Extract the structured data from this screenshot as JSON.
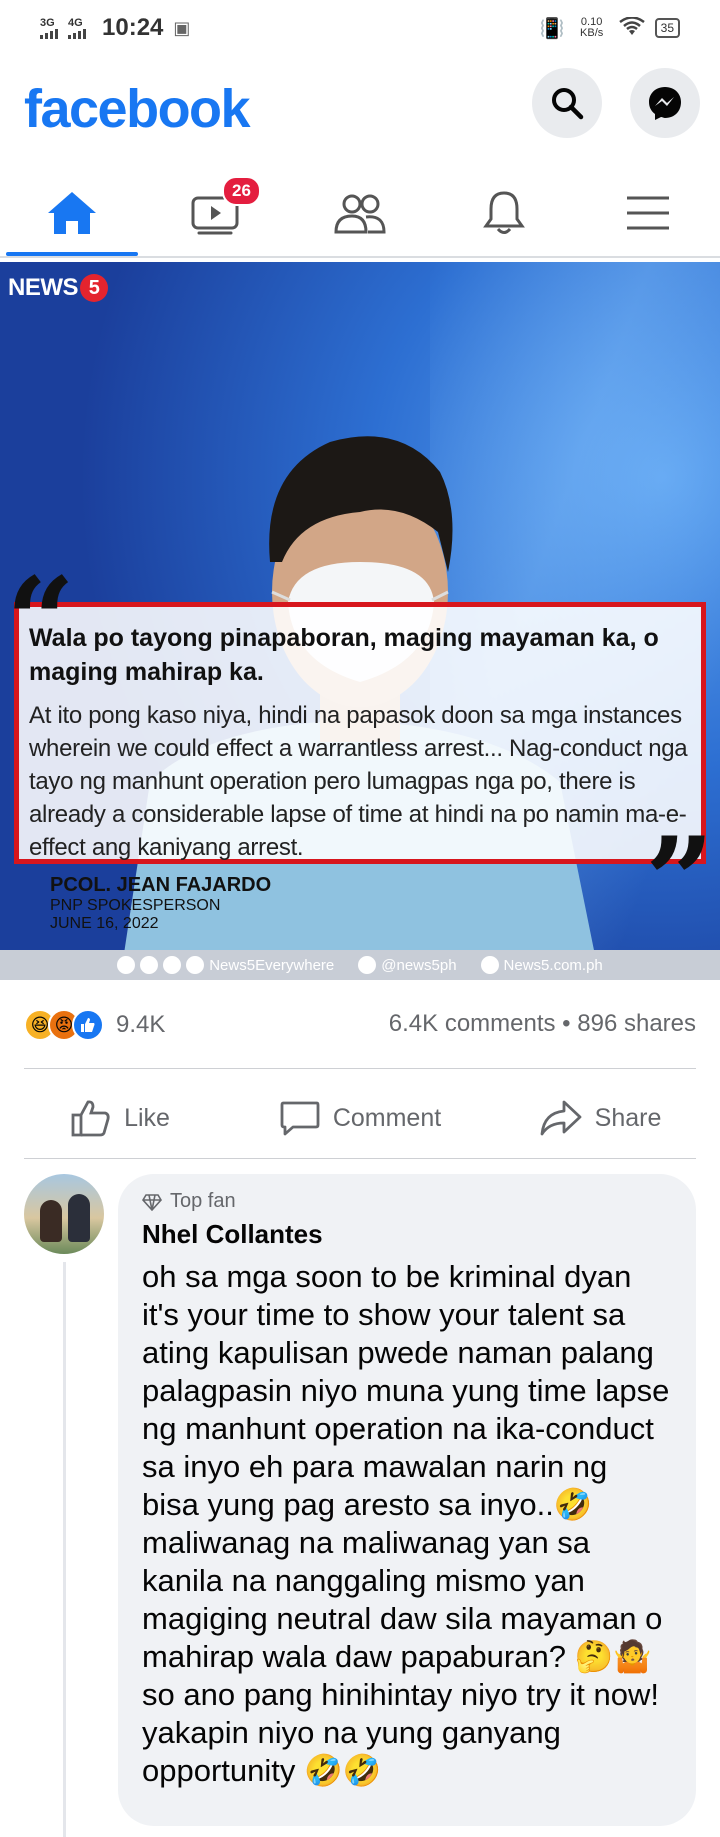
{
  "status_bar": {
    "net1": "3G",
    "net2": "4G",
    "time": "10:24",
    "speed": "0.10 KB/s",
    "battery": "35"
  },
  "header": {
    "logo": "facebook",
    "icons": [
      "search-icon",
      "messenger-icon"
    ]
  },
  "nav": {
    "tabs": [
      {
        "name": "home",
        "icon": "home-icon",
        "active": true
      },
      {
        "name": "watch",
        "icon": "video-icon",
        "badge": "26"
      },
      {
        "name": "friends",
        "icon": "friends-icon"
      },
      {
        "name": "notifications",
        "icon": "bell-icon"
      },
      {
        "name": "menu",
        "icon": "hamburger-icon"
      }
    ]
  },
  "post": {
    "brand": "NEWS",
    "brand_number": "5",
    "quote_title": "Wala po tayong pinapaboran, maging mayaman ka, o maging mahirap ka.",
    "quote_body": "At ito pong kaso niya, hindi na papasok doon sa mga instances wherein we could effect a warrantless arrest... Nag-conduct nga tayo ng manhunt operation pero lumagpas nga po, there is already a considerable lapse of time at hindi na po namin ma-e-effect ang kaniyang arrest.",
    "speaker_name": "PCOL. JEAN FAJARDO",
    "speaker_role": "PNP SPOKESPERSON",
    "speaker_date": "JUNE 16, 2022",
    "social": {
      "handle1": "News5Everywhere",
      "handle2": "@news5ph",
      "handle3": "News5.com.ph"
    }
  },
  "engagement": {
    "reactions": [
      "haha",
      "angry",
      "like"
    ],
    "reaction_count": "9.4K",
    "comments_shares": "6.4K comments • 896 shares"
  },
  "actions": {
    "like": "Like",
    "comment": "Comment",
    "share": "Share"
  },
  "comment": {
    "badge": "Top fan",
    "author": "Nhel Collantes",
    "text": "oh sa mga soon to be kriminal dyan it's your time to show your talent sa ating kapulisan pwede naman palang palagpasin niyo muna yung time lapse ng manhunt operation na ika-conduct sa inyo eh para mawalan narin ng bisa yung pag aresto sa inyo..🤣 maliwanag na maliwanag yan sa kanila na nanggaling mismo yan magiging neutral daw sila mayaman o mahirap wala daw papaburan? 🤔🤷 so ano pang hinihintay niyo try it now! yakapin niyo na yung ganyang opportunity 🤣🤣"
  },
  "colors": {
    "brand_blue": "#1877f2",
    "badge_red": "#e41e3f",
    "quote_border": "#d7161d"
  }
}
